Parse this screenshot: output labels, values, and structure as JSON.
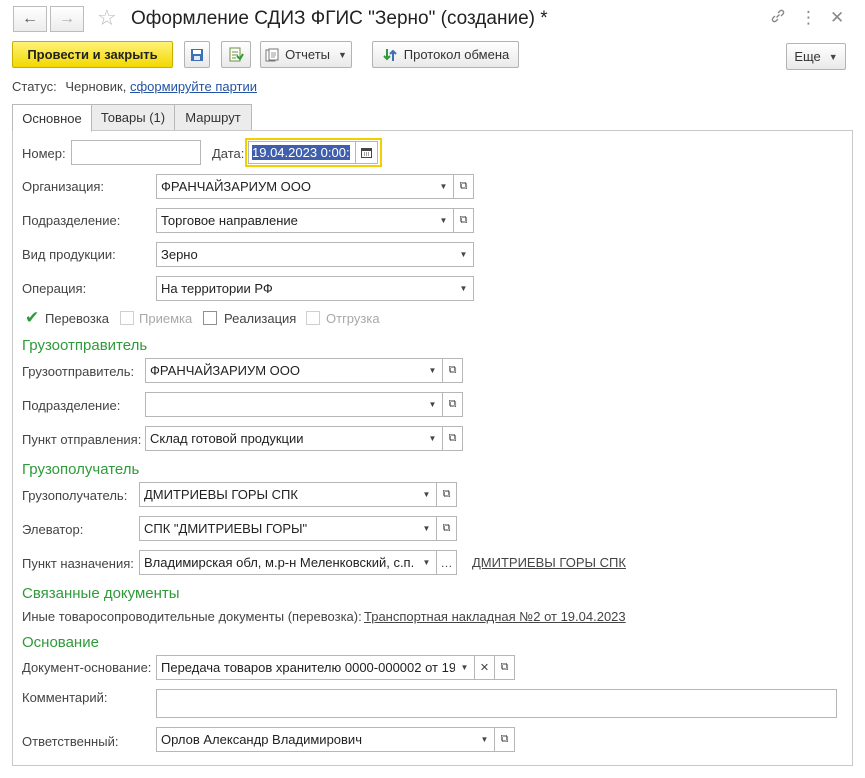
{
  "window": {
    "title": "Оформление СДИЗ ФГИС \"Зерно\" (создание) *",
    "back_icon": "←",
    "forward_icon": "→",
    "link_icon": "🔗",
    "menu_icon": "⋮",
    "close_icon": "✕"
  },
  "toolbar": {
    "post_close_label": "Провести и закрыть",
    "reports_label": "Отчеты",
    "exchange_label": "Протокол обмена",
    "more_label": "Еще"
  },
  "status": {
    "label": "Статус:",
    "value": "Черновик,",
    "link": "сформируйте партии"
  },
  "tabs": [
    {
      "label": "Основное"
    },
    {
      "label": "Товары (1)"
    },
    {
      "label": "Маршрут"
    }
  ],
  "form": {
    "number_label": "Номер:",
    "number_value": "",
    "date_label": "Дата:",
    "date_value": "19.04.2023  0:00:",
    "org_label": "Организация:",
    "org_value": "ФРАНЧАЙЗАРИУМ ООО",
    "subdiv_label": "Подразделение:",
    "subdiv_value": "Торговое направление",
    "product_label": "Вид продукции:",
    "product_value": "Зерно",
    "operation_label": "Операция:",
    "operation_value": "На территории РФ"
  },
  "checkboxes": [
    {
      "label": "Перевозка",
      "checked": true,
      "disabled": false
    },
    {
      "label": "Приемка",
      "checked": false,
      "disabled": true
    },
    {
      "label": "Реализация",
      "checked": false,
      "disabled": false
    },
    {
      "label": "Отгрузка",
      "checked": false,
      "disabled": true
    }
  ],
  "shipper": {
    "heading": "Грузоотправитель",
    "shipper_label": "Грузоотправитель:",
    "shipper_value": "ФРАНЧАЙЗАРИУМ ООО",
    "subdiv_label": "Подразделение:",
    "subdiv_value": "",
    "point_label": "Пункт отправления:",
    "point_value": "Склад готовой продукции"
  },
  "consignee": {
    "heading": "Грузополучатель",
    "consignee_label": "Грузополучатель:",
    "consignee_value": "ДМИТРИЕВЫ ГОРЫ СПК",
    "elevator_label": "Элеватор:",
    "elevator_value": "СПК \"ДМИТРИЕВЫ ГОРЫ\"",
    "dest_label": "Пункт назначения:",
    "dest_value": "Владимирская обл, м.р-н Меленковский, с.п. ",
    "dest_link": "ДМИТРИЕВЫ ГОРЫ СПК"
  },
  "related": {
    "heading": "Связанные документы",
    "docs_label": "Иные товаросопроводительные документы (перевозка):",
    "docs_link": "Транспортная накладная №2 от 19.04.2023"
  },
  "basis": {
    "heading": "Основание",
    "basis_label": "Документ-основание:",
    "basis_value": "Передача товаров хранителю 0000-000002 от 19.",
    "comment_label": "Комментарий:",
    "comment_value": "",
    "responsible_label": "Ответственный:",
    "responsible_value": "Орлов Александр Владимирович"
  },
  "colors": {
    "accent": "#f2d800",
    "section": "#2f9a3a",
    "link": "#2453a4"
  }
}
